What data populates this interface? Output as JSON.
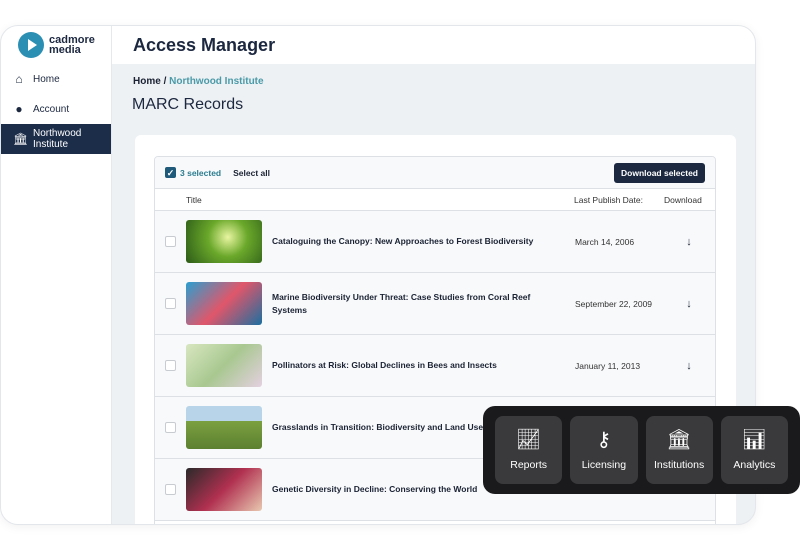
{
  "brand": {
    "line1": "cadmore",
    "line2": "media"
  },
  "sidebar": {
    "items": [
      {
        "label": "Home",
        "icon": "home-icon"
      },
      {
        "label": "Account",
        "icon": "user-icon"
      },
      {
        "label": "Northwood Institute",
        "icon": "institution-icon",
        "active": true
      }
    ]
  },
  "header": {
    "title": "Access Manager"
  },
  "breadcrumb": {
    "home": "Home",
    "sep": "/",
    "current": "Northwood Institute"
  },
  "page": {
    "title": "MARC Records"
  },
  "toolbar": {
    "selected": "3 selected",
    "select_all": "Select all",
    "download_selected": "Download selected"
  },
  "columns": {
    "title": "Title",
    "date": "Last Publish Date:",
    "download": "Download"
  },
  "rows": [
    {
      "title": "Cataloguing the Canopy: New Approaches to Forest Biodiversity",
      "date": "March 14, 2006",
      "dl": "↓",
      "thumb": "forest"
    },
    {
      "title": "Marine Biodiversity Under Threat: Case Studies from Coral Reef Systems",
      "date": "September 22, 2009",
      "dl": "↓",
      "thumb": "coral"
    },
    {
      "title": "Pollinators at Risk: Global Declines in Bees and Insects",
      "date": "January 11, 2013",
      "dl": "↓",
      "thumb": "bee"
    },
    {
      "title": "Grasslands in Transition: Biodiversity and Land Use",
      "date": "",
      "dl": "",
      "thumb": "grass"
    },
    {
      "title": "Genetic Diversity in Decline: Conserving the World",
      "date": "",
      "dl": "",
      "thumb": "seeds"
    }
  ],
  "dock": [
    {
      "label": "Reports",
      "icon": "line-chart-icon"
    },
    {
      "label": "Licensing",
      "icon": "key-icon"
    },
    {
      "label": "Institutions",
      "icon": "institution-icon"
    },
    {
      "label": "Analytics",
      "icon": "bar-chart-icon"
    }
  ],
  "colors": {
    "navy": "#1c2840",
    "teal": "#4a9aa8",
    "dock": "#1a1a1c"
  }
}
